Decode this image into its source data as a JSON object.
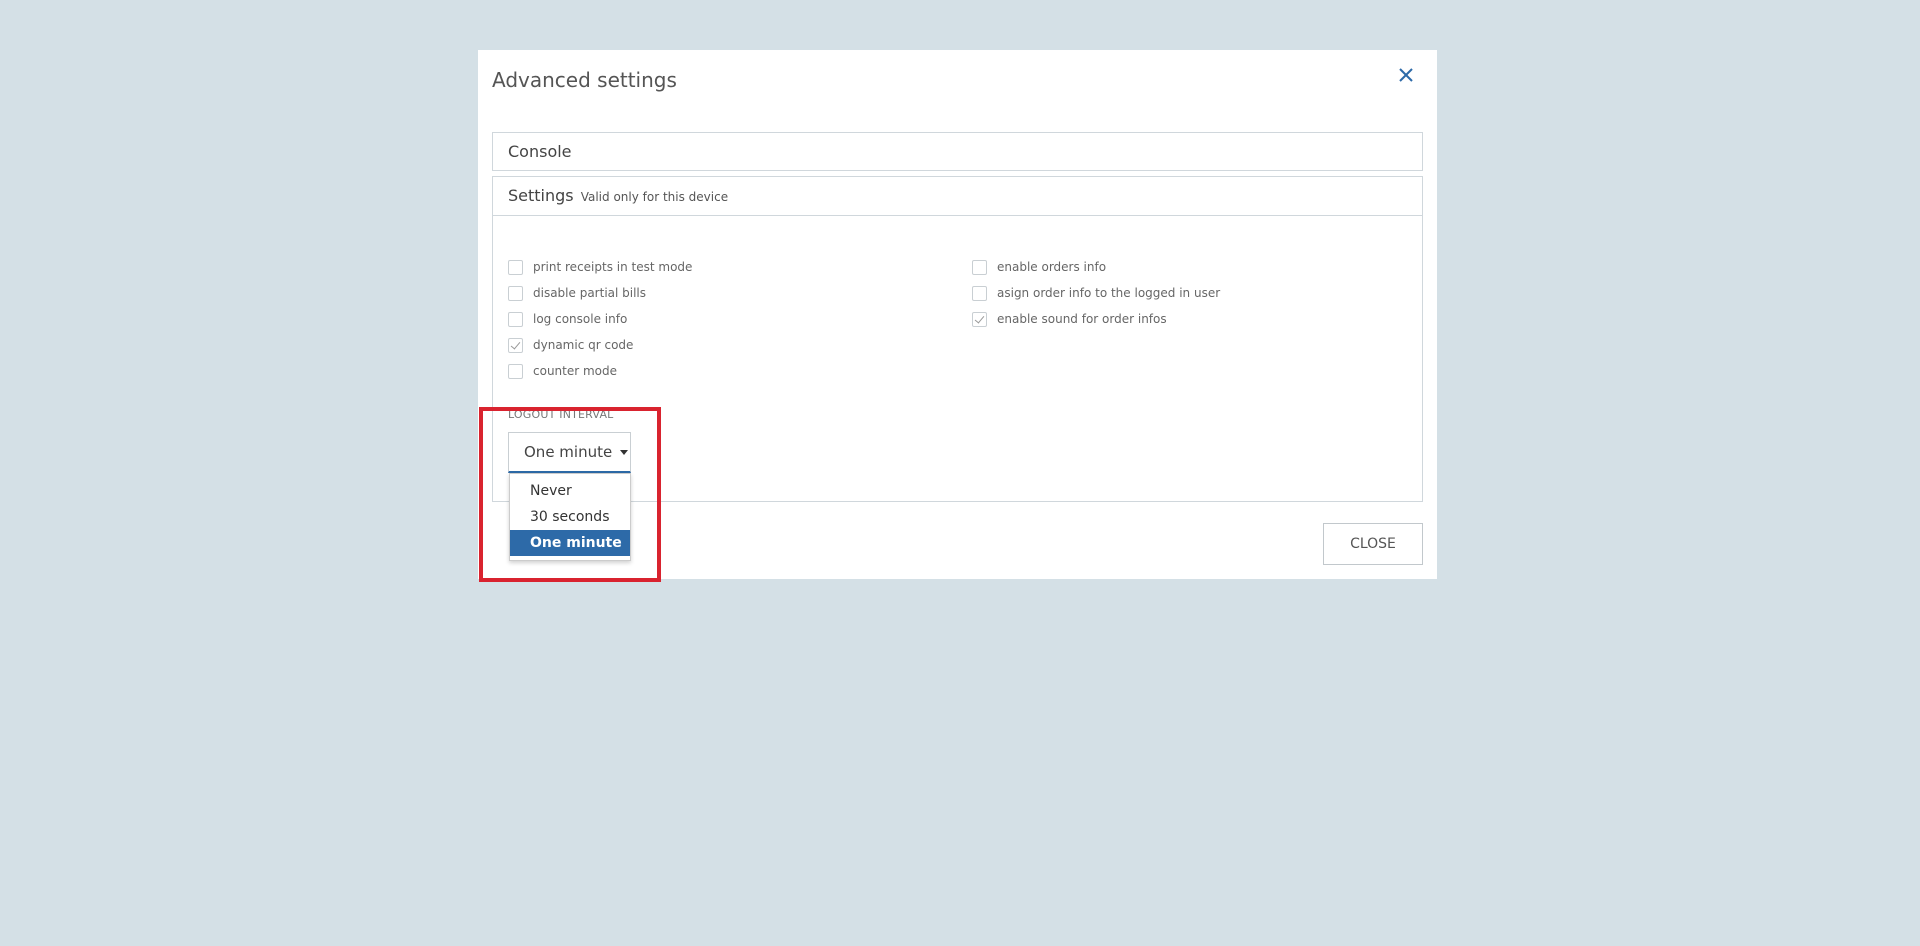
{
  "dialog": {
    "title": "Advanced settings",
    "close_icon": "close-icon"
  },
  "console_panel": {
    "heading": "Console"
  },
  "settings_panel": {
    "heading": "Settings",
    "hint": "Valid only for this device",
    "left_options": [
      {
        "label": "print receipts in test mode",
        "checked": false
      },
      {
        "label": "disable partial bills",
        "checked": false
      },
      {
        "label": "log console info",
        "checked": false
      },
      {
        "label": "dynamic qr code",
        "checked": true
      },
      {
        "label": "counter mode",
        "checked": false
      }
    ],
    "right_options": [
      {
        "label": "enable orders info",
        "checked": false
      },
      {
        "label": "asign order info to the logged in user",
        "checked": false
      },
      {
        "label": "enable sound for order infos",
        "checked": true
      }
    ],
    "logout_interval": {
      "label": "LOGOUT INTERVAL",
      "selected": "One minute",
      "options": [
        "Never",
        "30 seconds",
        "One minute"
      ]
    }
  },
  "footer": {
    "close_label": "CLOSE"
  },
  "colors": {
    "background": "#d4e0e6",
    "accent": "#2d6aa8",
    "highlight": "#d9232f"
  }
}
